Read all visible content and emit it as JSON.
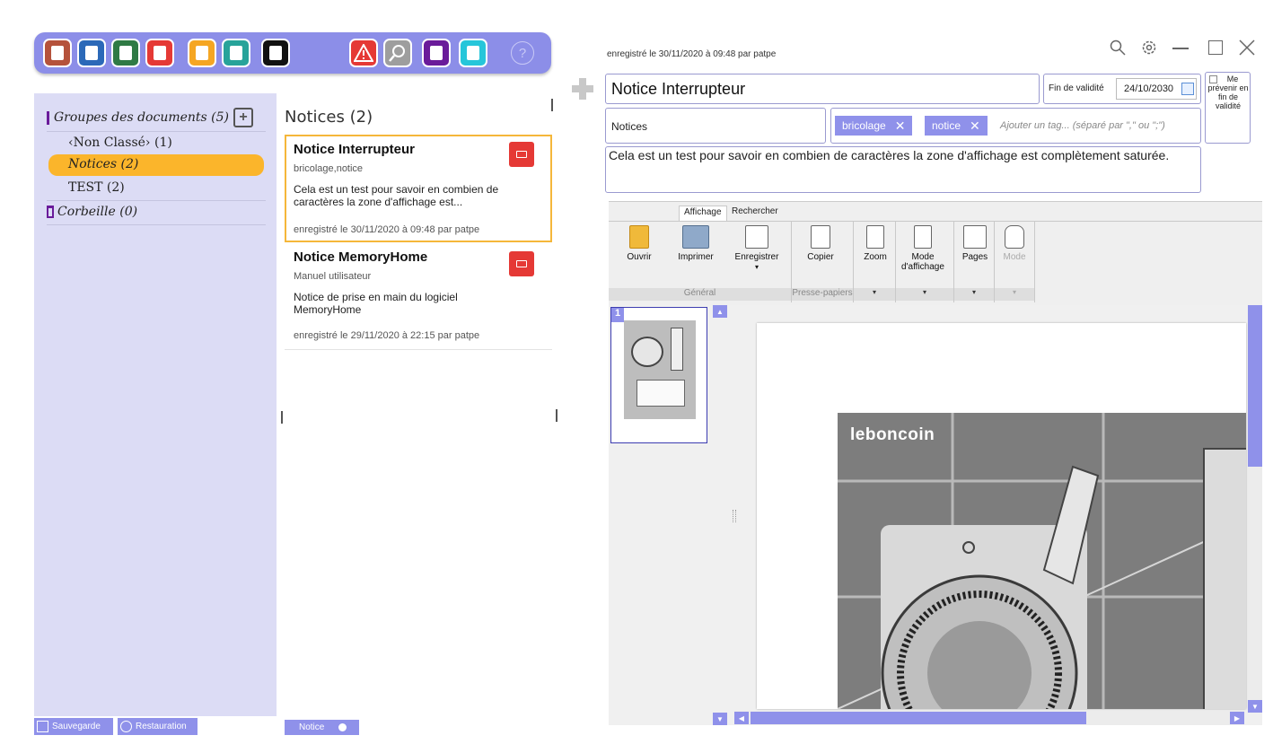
{
  "toolbar": {
    "buttons": [
      {
        "name": "hourglass-icon",
        "color": "#b5523b"
      },
      {
        "name": "document-icon",
        "color": "#2b69b8"
      },
      {
        "name": "spreadsheet-icon",
        "color": "#2f7a45"
      },
      {
        "name": "pdf-icon",
        "color": "#e53935"
      },
      {
        "name": "image-icon",
        "color": "#f5a623"
      },
      {
        "name": "text-file-icon",
        "color": "#27a39a"
      },
      {
        "name": "book-icon",
        "color": "#111111"
      },
      {
        "name": "warning-icon",
        "color": "#e53935"
      },
      {
        "name": "search-icon",
        "color": "#9e9e9e"
      },
      {
        "name": "clipboard-icon",
        "color": "#6a1b9a"
      },
      {
        "name": "calculator-icon",
        "color": "#26c6da"
      }
    ],
    "help": "?"
  },
  "groups": {
    "header": "Groupes des documents (5)",
    "items": [
      "‹Non Classé› (1)",
      "Notices (2)",
      "TEST (2)"
    ],
    "trash": "Corbeille (0)"
  },
  "footer": {
    "backup": "Sauvegarde",
    "restore": "Restauration",
    "notice": "Notice"
  },
  "list": {
    "title": "Notices (2)",
    "cards": [
      {
        "title": "Notice Interrupteur",
        "tags": "bricolage,notice",
        "body": "Cela est un test pour savoir en combien de caractères la zone d'affichage est...",
        "meta": "enregistré le 30/11/2020 à 09:48 par patpe"
      },
      {
        "title": "Notice MemoryHome",
        "tags": "Manuel utilisateur",
        "body": "Notice de prise en main du logiciel MemoryHome",
        "meta": "enregistré le 29/11/2020 à 22:15 par patpe"
      }
    ]
  },
  "detail": {
    "meta": "enregistré le 30/11/2020 à 09:48 par patpe",
    "title": "Notice Interrupteur",
    "validity_label": "Fin de validité",
    "validity_date": "24/10/2030",
    "notify": "Me prévenir en fin de validité",
    "group": "Notices",
    "tags": [
      "bricolage",
      "notice"
    ],
    "tag_placeholder": "Ajouter un tag... (séparé par \",\" ou \";\")",
    "description": "Cela est un test pour savoir en combien de caractères la zone d'affichage est complètement saturée."
  },
  "ribbon": {
    "tabs": [
      "Affichage",
      "Rechercher"
    ],
    "buttons": [
      "Ouvrir",
      "Imprimer",
      "Enregistrer",
      "Copier",
      "Zoom",
      "Mode d'affichage",
      "Pages",
      "Mode"
    ],
    "groups": [
      "Général",
      "Presse-papiers"
    ]
  },
  "viewer": {
    "page_number": "1",
    "watermark": "leboncoin"
  }
}
